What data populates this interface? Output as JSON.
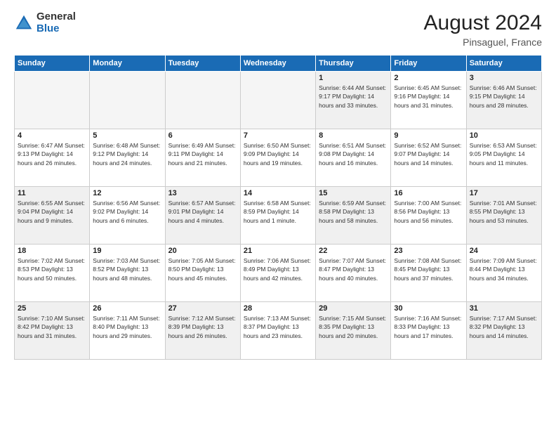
{
  "header": {
    "logo_general": "General",
    "logo_blue": "Blue",
    "month_title": "August 2024",
    "location": "Pinsaguel, France"
  },
  "weekdays": [
    "Sunday",
    "Monday",
    "Tuesday",
    "Wednesday",
    "Thursday",
    "Friday",
    "Saturday"
  ],
  "weeks": [
    [
      {
        "day": "",
        "info": ""
      },
      {
        "day": "",
        "info": ""
      },
      {
        "day": "",
        "info": ""
      },
      {
        "day": "",
        "info": ""
      },
      {
        "day": "1",
        "info": "Sunrise: 6:44 AM\nSunset: 9:17 PM\nDaylight: 14 hours\nand 33 minutes."
      },
      {
        "day": "2",
        "info": "Sunrise: 6:45 AM\nSunset: 9:16 PM\nDaylight: 14 hours\nand 31 minutes."
      },
      {
        "day": "3",
        "info": "Sunrise: 6:46 AM\nSunset: 9:15 PM\nDaylight: 14 hours\nand 28 minutes."
      }
    ],
    [
      {
        "day": "4",
        "info": "Sunrise: 6:47 AM\nSunset: 9:13 PM\nDaylight: 14 hours\nand 26 minutes."
      },
      {
        "day": "5",
        "info": "Sunrise: 6:48 AM\nSunset: 9:12 PM\nDaylight: 14 hours\nand 24 minutes."
      },
      {
        "day": "6",
        "info": "Sunrise: 6:49 AM\nSunset: 9:11 PM\nDaylight: 14 hours\nand 21 minutes."
      },
      {
        "day": "7",
        "info": "Sunrise: 6:50 AM\nSunset: 9:09 PM\nDaylight: 14 hours\nand 19 minutes."
      },
      {
        "day": "8",
        "info": "Sunrise: 6:51 AM\nSunset: 9:08 PM\nDaylight: 14 hours\nand 16 minutes."
      },
      {
        "day": "9",
        "info": "Sunrise: 6:52 AM\nSunset: 9:07 PM\nDaylight: 14 hours\nand 14 minutes."
      },
      {
        "day": "10",
        "info": "Sunrise: 6:53 AM\nSunset: 9:05 PM\nDaylight: 14 hours\nand 11 minutes."
      }
    ],
    [
      {
        "day": "11",
        "info": "Sunrise: 6:55 AM\nSunset: 9:04 PM\nDaylight: 14 hours\nand 9 minutes."
      },
      {
        "day": "12",
        "info": "Sunrise: 6:56 AM\nSunset: 9:02 PM\nDaylight: 14 hours\nand 6 minutes."
      },
      {
        "day": "13",
        "info": "Sunrise: 6:57 AM\nSunset: 9:01 PM\nDaylight: 14 hours\nand 4 minutes."
      },
      {
        "day": "14",
        "info": "Sunrise: 6:58 AM\nSunset: 8:59 PM\nDaylight: 14 hours\nand 1 minute."
      },
      {
        "day": "15",
        "info": "Sunrise: 6:59 AM\nSunset: 8:58 PM\nDaylight: 13 hours\nand 58 minutes."
      },
      {
        "day": "16",
        "info": "Sunrise: 7:00 AM\nSunset: 8:56 PM\nDaylight: 13 hours\nand 56 minutes."
      },
      {
        "day": "17",
        "info": "Sunrise: 7:01 AM\nSunset: 8:55 PM\nDaylight: 13 hours\nand 53 minutes."
      }
    ],
    [
      {
        "day": "18",
        "info": "Sunrise: 7:02 AM\nSunset: 8:53 PM\nDaylight: 13 hours\nand 50 minutes."
      },
      {
        "day": "19",
        "info": "Sunrise: 7:03 AM\nSunset: 8:52 PM\nDaylight: 13 hours\nand 48 minutes."
      },
      {
        "day": "20",
        "info": "Sunrise: 7:05 AM\nSunset: 8:50 PM\nDaylight: 13 hours\nand 45 minutes."
      },
      {
        "day": "21",
        "info": "Sunrise: 7:06 AM\nSunset: 8:49 PM\nDaylight: 13 hours\nand 42 minutes."
      },
      {
        "day": "22",
        "info": "Sunrise: 7:07 AM\nSunset: 8:47 PM\nDaylight: 13 hours\nand 40 minutes."
      },
      {
        "day": "23",
        "info": "Sunrise: 7:08 AM\nSunset: 8:45 PM\nDaylight: 13 hours\nand 37 minutes."
      },
      {
        "day": "24",
        "info": "Sunrise: 7:09 AM\nSunset: 8:44 PM\nDaylight: 13 hours\nand 34 minutes."
      }
    ],
    [
      {
        "day": "25",
        "info": "Sunrise: 7:10 AM\nSunset: 8:42 PM\nDaylight: 13 hours\nand 31 minutes."
      },
      {
        "day": "26",
        "info": "Sunrise: 7:11 AM\nSunset: 8:40 PM\nDaylight: 13 hours\nand 29 minutes."
      },
      {
        "day": "27",
        "info": "Sunrise: 7:12 AM\nSunset: 8:39 PM\nDaylight: 13 hours\nand 26 minutes."
      },
      {
        "day": "28",
        "info": "Sunrise: 7:13 AM\nSunset: 8:37 PM\nDaylight: 13 hours\nand 23 minutes."
      },
      {
        "day": "29",
        "info": "Sunrise: 7:15 AM\nSunset: 8:35 PM\nDaylight: 13 hours\nand 20 minutes."
      },
      {
        "day": "30",
        "info": "Sunrise: 7:16 AM\nSunset: 8:33 PM\nDaylight: 13 hours\nand 17 minutes."
      },
      {
        "day": "31",
        "info": "Sunrise: 7:17 AM\nSunset: 8:32 PM\nDaylight: 13 hours\nand 14 minutes."
      }
    ]
  ]
}
